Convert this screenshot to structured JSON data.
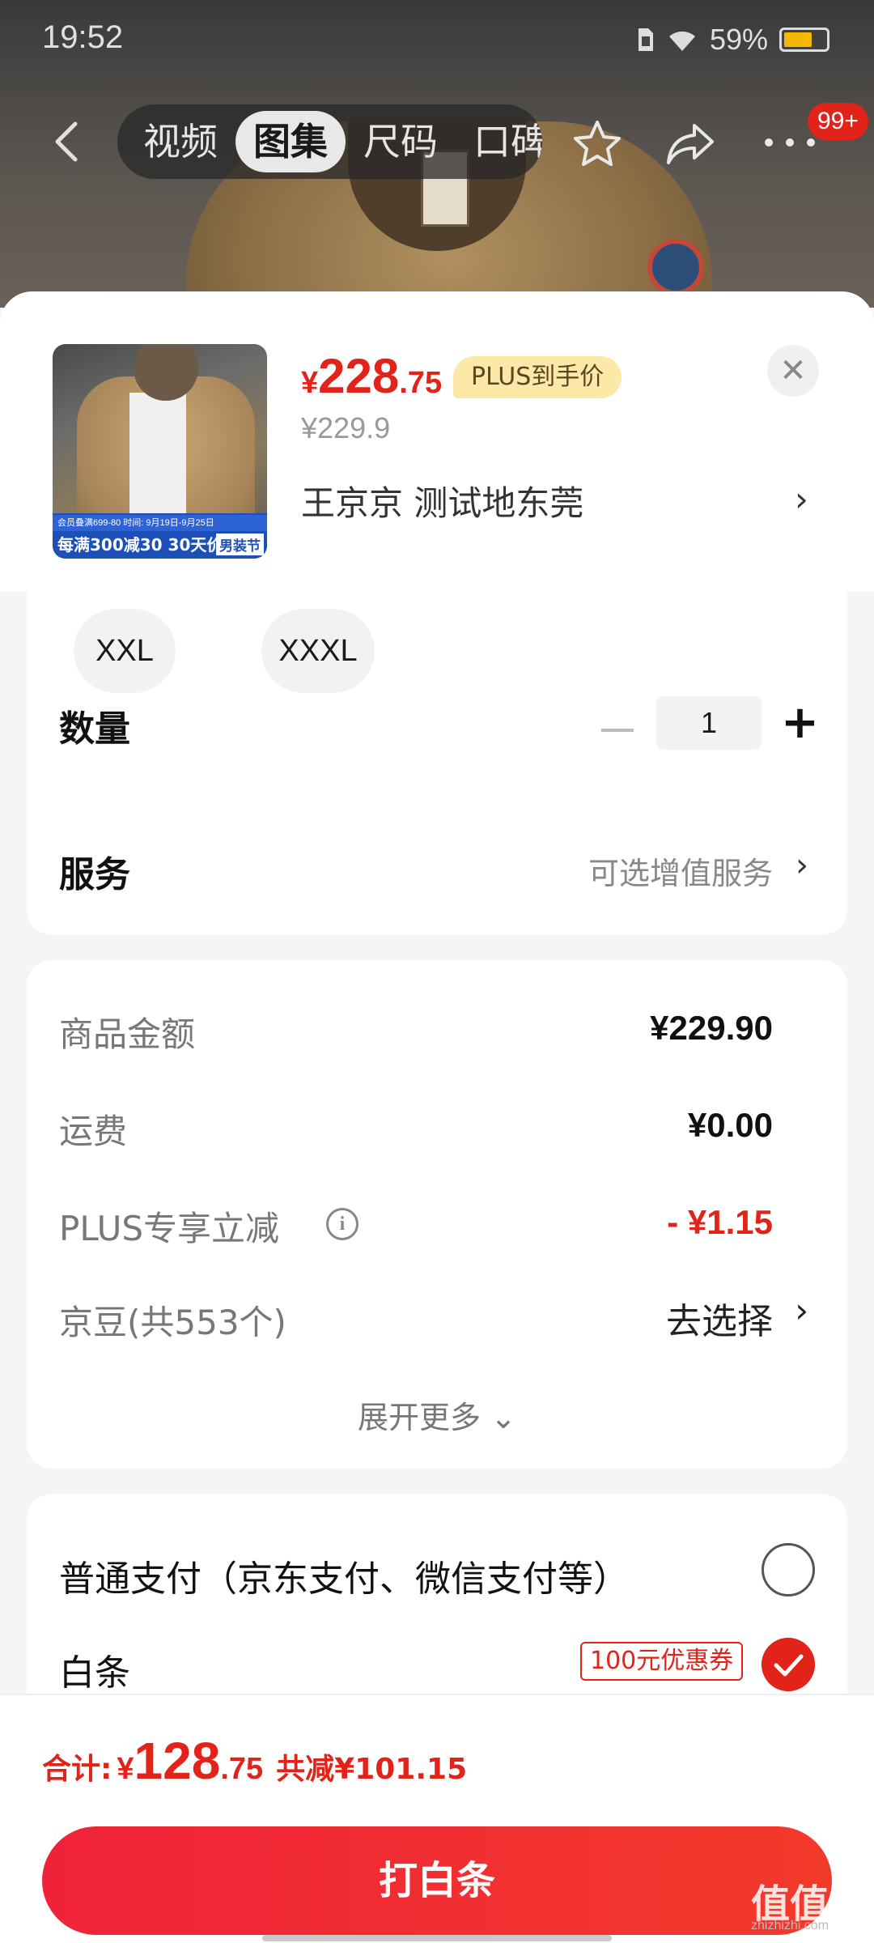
{
  "status_bar": {
    "time": "19:52",
    "battery": "59%"
  },
  "nav": {
    "tabs": [
      "视频",
      "图集",
      "尺码",
      "口碑"
    ],
    "active_tab": "图集",
    "badge": "99+"
  },
  "product": {
    "price_symbol": "¥",
    "price_integer": "228",
    "price_decimal": ".75",
    "plus_tag": "PLUS到手价",
    "original_price": "¥229.9",
    "address": "王京京  测试地东莞",
    "thumbnail": {
      "banner_small": "会员叠满699-80    时间: 9月19日-9月25日",
      "banner_text": "每满300减30  30天价保",
      "banner_tag": "男装节"
    }
  },
  "sizes": [
    "XXL",
    "XXXL"
  ],
  "quantity": {
    "label": "数量",
    "value": "1"
  },
  "service": {
    "label": "服务",
    "value": "可选增值服务"
  },
  "amounts": {
    "goods_label": "商品金额",
    "goods_value": "¥229.90",
    "shipping_label": "运费",
    "shipping_value": "¥0.00",
    "plus_label": "PLUS专享立减",
    "plus_value": "- ¥1.15",
    "jd_beans_label": "京豆(共553个)",
    "jd_beans_action": "去选择",
    "expand": "展开更多"
  },
  "payment": {
    "normal_label": "普通支付（京东支付、微信支付等）",
    "baitiao_label": "白条",
    "coupon": "100元优惠券"
  },
  "bottom": {
    "total_label": "合计:",
    "total_symbol": "¥",
    "total_integer": "128",
    "total_decimal": ".75",
    "total_savings": "共减¥101.15",
    "pay_button": "打白条"
  },
  "watermark": {
    "text": "值值值",
    "sub": "zhizhizhi.com"
  },
  "colors": {
    "accent": "#e2231a",
    "plus_tag_bg": "#fce9a8",
    "button": "#f0223a"
  }
}
